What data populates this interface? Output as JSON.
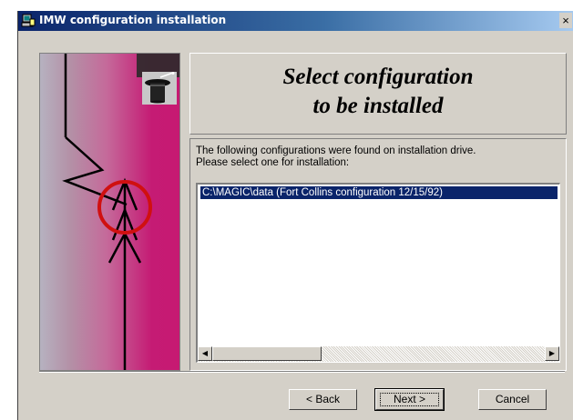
{
  "window": {
    "title": "IMW configuration installation",
    "close_glyph": "×",
    "icon": "setup-computer-icon"
  },
  "heading": {
    "line1": "Select configuration",
    "line2": "to be installed"
  },
  "instructions": {
    "line1": "The following configurations were found on installation drive.",
    "line2": "Please select one for installation:"
  },
  "config_list": {
    "items": [
      {
        "label": "C:\\MAGIC\\data (Fort Collins configuration 12/15/92)",
        "selected": true
      }
    ]
  },
  "scrollbar": {
    "left_arrow": "◀",
    "right_arrow": "▶"
  },
  "buttons": {
    "back": "< Back",
    "next": "Next >",
    "cancel": "Cancel"
  },
  "art": {
    "hat_icon": "magic-hat-icon"
  }
}
